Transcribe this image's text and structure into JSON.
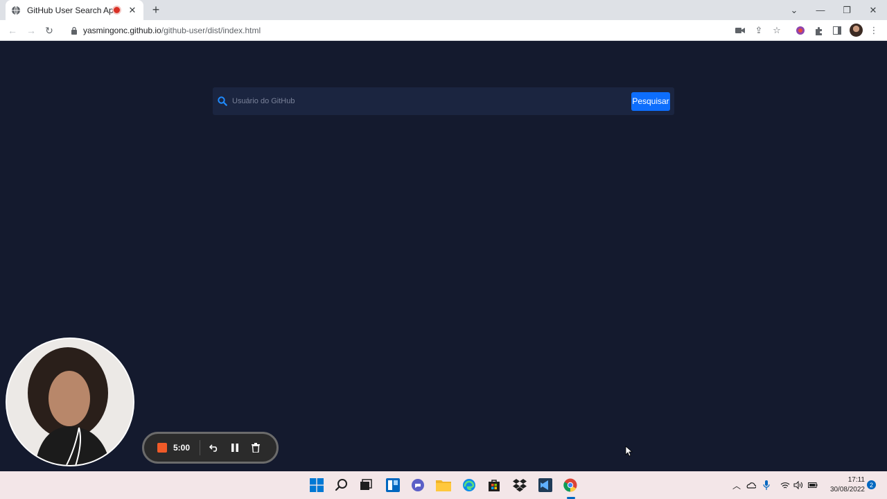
{
  "browser": {
    "tab": {
      "title": "GitHub User Search App"
    },
    "url": {
      "host": "yasmingonc.github.io",
      "path": "/github-user/dist/index.html"
    }
  },
  "search": {
    "placeholder": "Usuário do GitHub",
    "value": "",
    "button_label": "Pesquisar"
  },
  "recorder": {
    "time": "5:00"
  },
  "taskbar": {
    "time": "17:11",
    "date": "30/08/2022",
    "notifications": "2"
  },
  "colors": {
    "page_background": "#141a2e",
    "search_background": "#1b2540",
    "accent": "#0d6efd"
  }
}
